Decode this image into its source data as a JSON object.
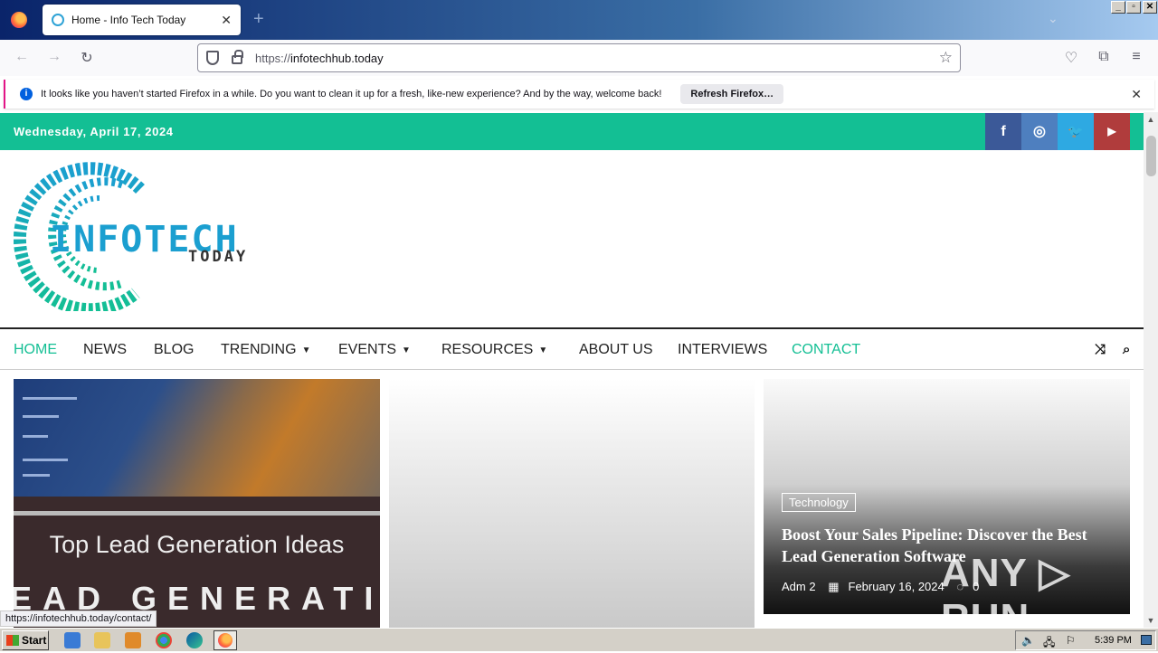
{
  "browser": {
    "tab_title": "Home - Info Tech Today",
    "url_scheme": "https://",
    "url_host": "infotechhub.today",
    "notification": {
      "text": "It looks like you haven’t started Firefox in a while. Do you want to clean it up for a fresh, like-new experience? And by the way, welcome back!",
      "button": "Refresh Firefox…"
    },
    "status_url": "https://infotechhub.today/contact/"
  },
  "site": {
    "date": "Wednesday, April 17, 2024",
    "social": [
      {
        "icon": "facebook-icon",
        "glyph": "f",
        "color": "#3b5998"
      },
      {
        "icon": "instagram-icon",
        "glyph": "◎",
        "color": "#4e7fbf"
      },
      {
        "icon": "twitter-icon",
        "glyph": "🐦",
        "color": "#2ea9e2"
      },
      {
        "icon": "youtube-icon",
        "glyph": "▶",
        "color": "#b03c3c"
      }
    ],
    "logo": {
      "main": "INFOTECH",
      "sub": "TODAY"
    },
    "nav": [
      "HOME",
      "NEWS",
      "BLOG",
      "TRENDING",
      "EVENTS",
      "RESOURCES",
      "ABOUT US",
      "INTERVIEWS",
      "CONTACT"
    ]
  },
  "cards": {
    "card1": {
      "title": "Top Lead Generation Ideas",
      "big_text": "EAD GENERATIO"
    },
    "card3": {
      "tag": "Technology",
      "title": "Boost Your Sales Pipeline: Discover the Best Lead Generation Software",
      "author": "Adm 2",
      "date": "February 16, 2024",
      "comments": "0"
    }
  },
  "watermark": "ANY ▷ RUN",
  "taskbar": {
    "start": "Start",
    "clock": "5:39 PM"
  },
  "colors": {
    "accent": "#13bf94",
    "link": "#1b9fd0"
  }
}
